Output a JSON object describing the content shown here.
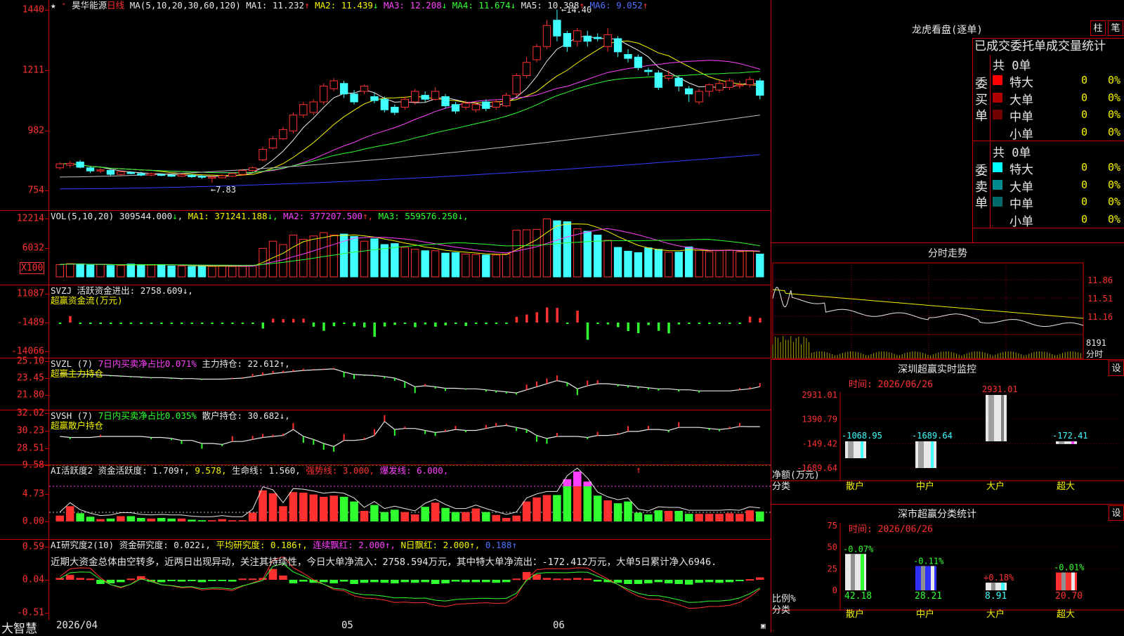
{
  "header": {
    "stock_name": "昊华能源",
    "period": "日线",
    "ma_params": "MA(5,10,20,30,60,120)",
    "ma_values": [
      {
        "label": "MA1:",
        "value": "11.232",
        "arrow": "↑",
        "color": "#e8e8e8"
      },
      {
        "label": "MA2:",
        "value": "11.439",
        "arrow": "↓",
        "color": "#f5f500"
      },
      {
        "label": "MA3:",
        "value": "12.208",
        "arrow": "↓",
        "color": "#ff40ff"
      },
      {
        "label": "MA4:",
        "value": "11.674",
        "arrow": "↓",
        "color": "#30ff30"
      },
      {
        "label": "MA5:",
        "value": "10.398",
        "arrow": "↑",
        "color": "#e8e8e8"
      },
      {
        "label": "MA6:",
        "value": "9.052",
        "arrow": "↑",
        "color": "#5070ff"
      }
    ],
    "high_mark": "14.40",
    "low_mark": "7.83"
  },
  "panels": {
    "price": {
      "ticks": [
        "1440",
        "1211",
        "982",
        "754"
      ]
    },
    "vol": {
      "ticks": [
        "12214",
        "6032"
      ],
      "unit_box": "X100",
      "label": "VOL(5,10,20)",
      "value": "309544.000",
      "value_arrow": "↓",
      "ma": [
        {
          "label": "MA1:",
          "value": "371241.188",
          "arrow": "↓",
          "color": "#f5f500"
        },
        {
          "label": "MA2:",
          "value": "377207.500",
          "arrow": "↑",
          "color": "#ff40ff"
        },
        {
          "label": "MA3:",
          "value": "559576.250",
          "arrow": "↓",
          "color": "#30ff30"
        }
      ]
    },
    "svzj": {
      "ticks": [
        "11087",
        "-1489",
        "-14066"
      ],
      "name": "SVZJ",
      "text": "活跃资金进出: 2758.609↓,",
      "subtitle": "超赢资金流(万元)"
    },
    "svzl": {
      "ticks": [
        "25.10",
        "23.45",
        "21.80"
      ],
      "name": "SVZL (7)",
      "ratio_text": "7日内买卖净占比0.071%",
      "text": "主力持仓: 22.612↑,",
      "subtitle": "超赢主力持仓"
    },
    "svsh": {
      "ticks": [
        "32.02",
        "30.23",
        "28.51"
      ],
      "name": "SVSH (7)",
      "ratio_text": "7日内买卖净占比0.035%",
      "text": "散户持仓: 30.682↓,",
      "subtitle": "超赢散户持仓"
    },
    "hyd": {
      "ticks": [
        "9.58",
        "4.73",
        "0.00"
      ],
      "name": "AI活跃度2",
      "text1": "资金活跃度: 1.709↑,",
      "text2": "9.578,",
      "text3": "生命线: 1.560,",
      "text4": "强势线: 3.000,",
      "text5": "爆发线: 6.000,",
      "arrow_mark": "↑"
    },
    "yjd": {
      "ticks": [
        "0.59",
        "0.04",
        "-0.51"
      ],
      "name": "AI研究度2(10)",
      "text1": "资金研究度: 0.022↓,",
      "text2": "平均研究度: 0.186↑,",
      "text3": "连续飘红: 2.000↑,",
      "text4": "N日飘红: 2.000↑,",
      "text5": "0.188↑",
      "commentary": "近期大资金总体由空转多，近两日出现异动，关注其持续性，今日大单净流入：2758.594万元，其中特大单净流出：-172.412万元，大单5日累计净入6946."
    }
  },
  "statusbar": {
    "brand": "大智慧",
    "date": "2026/04",
    "month1": "05",
    "month2": "06"
  },
  "right": {
    "lhkp": {
      "title": "龙虎看盘(逐单)",
      "btn1": "柱",
      "btn2": "笔",
      "tabs": "已成交委托单成交量统计",
      "buy": {
        "group_label": "委买单",
        "total": "共 0单",
        "rows": [
          {
            "label": "特大",
            "value": "0",
            "pct": "0%",
            "color": "#ff0000"
          },
          {
            "label": "大单",
            "value": "0",
            "pct": "0%",
            "color": "#b00000"
          },
          {
            "label": "中单",
            "value": "0",
            "pct": "0%",
            "color": "#700000"
          },
          {
            "label": "小单",
            "value": "0",
            "pct": "0%",
            "color": "#000000"
          }
        ]
      },
      "sell": {
        "group_label": "委卖单",
        "total": "共 0单",
        "rows": [
          {
            "label": "特大",
            "value": "0",
            "pct": "0%",
            "color": "#00ffff"
          },
          {
            "label": "大单",
            "value": "0",
            "pct": "0%",
            "color": "#008c8c"
          },
          {
            "label": "中单",
            "value": "0",
            "pct": "0%",
            "color": "#006a6a"
          },
          {
            "label": "小单",
            "value": "0",
            "pct": "0%",
            "color": "#000000"
          }
        ]
      }
    },
    "fszs": {
      "title": "分时走势",
      "ticks": [
        "11.86",
        "11.51",
        "11.16"
      ],
      "vol_tick": "8191",
      "vol_label": "分时"
    },
    "szjk": {
      "title": "深圳超赢实时监控",
      "settings": "设",
      "date_label": "时间: 2026/06/26",
      "ticks": [
        "2931.01",
        "1390.79",
        "-149.42",
        "-1689.64"
      ],
      "ylabel": "净额(万元)",
      "xlabel": "分类"
    },
    "fltj": {
      "title": "深市超赢分类统计",
      "settings": "设",
      "date_label": "时间: 2026/06/26",
      "ticks": [
        "75",
        "50",
        "25",
        "0"
      ],
      "ylabel": "比例%",
      "xlabel": "分类"
    }
  },
  "chart_data": [
    {
      "type": "candlestick",
      "title": "昊华能源 日线",
      "ylim": [
        7.3,
        14.5
      ],
      "ohlc": [
        [
          8.4,
          8.55,
          8.6,
          8.33
        ],
        [
          8.5,
          8.57,
          8.65,
          8.4
        ],
        [
          8.62,
          8.42,
          8.7,
          8.38
        ],
        [
          8.4,
          8.28,
          8.45,
          8.2
        ],
        [
          8.3,
          8.32,
          8.38,
          8.2
        ],
        [
          8.3,
          8.15,
          8.35,
          8.1
        ],
        [
          8.15,
          8.25,
          8.3,
          8.1
        ],
        [
          8.22,
          8.2,
          8.26,
          8.15
        ],
        [
          8.18,
          8.12,
          8.25,
          8.08
        ],
        [
          8.12,
          8.18,
          8.22,
          8.08
        ],
        [
          8.15,
          8.12,
          8.18,
          8.08
        ],
        [
          8.12,
          8.08,
          8.16,
          8.05
        ],
        [
          8.08,
          8.14,
          8.18,
          8.05
        ],
        [
          8.12,
          8.06,
          8.16,
          8.02
        ],
        [
          8.08,
          8.05,
          8.12,
          7.98
        ],
        [
          8.05,
          8.05,
          8.1,
          7.83
        ],
        [
          8.02,
          8.1,
          8.15,
          8.0
        ],
        [
          8.08,
          8.18,
          8.22,
          8.05
        ],
        [
          8.15,
          8.3,
          8.35,
          8.1
        ],
        [
          8.3,
          8.4,
          8.45,
          8.25
        ],
        [
          8.7,
          9.1,
          9.2,
          8.65
        ],
        [
          9.15,
          9.5,
          9.6,
          9.1
        ],
        [
          9.5,
          9.85,
          9.95,
          9.45
        ],
        [
          9.8,
          10.4,
          10.5,
          9.7
        ],
        [
          10.4,
          10.8,
          10.9,
          10.3
        ],
        [
          10.5,
          10.9,
          11.0,
          10.4
        ],
        [
          10.9,
          11.5,
          11.6,
          10.8
        ],
        [
          11.4,
          11.7,
          11.8,
          11.3
        ],
        [
          11.6,
          11.2,
          11.7,
          11.05
        ],
        [
          11.2,
          10.9,
          11.35,
          10.8
        ],
        [
          11.3,
          11.5,
          11.55,
          11.2
        ],
        [
          11.1,
          10.95,
          11.25,
          10.85
        ],
        [
          11.0,
          10.6,
          11.1,
          10.5
        ],
        [
          10.7,
          10.5,
          10.8,
          10.4
        ],
        [
          10.7,
          11.0,
          11.1,
          10.6
        ],
        [
          10.9,
          11.3,
          11.4,
          10.8
        ],
        [
          11.15,
          11.0,
          11.3,
          10.9
        ],
        [
          11.0,
          11.3,
          11.45,
          10.95
        ],
        [
          11.1,
          10.75,
          11.2,
          10.65
        ],
        [
          10.8,
          10.55,
          10.9,
          10.45
        ],
        [
          10.7,
          10.85,
          10.95,
          10.6
        ],
        [
          10.6,
          10.8,
          10.9,
          10.5
        ],
        [
          10.9,
          10.65,
          11.0,
          10.55
        ],
        [
          10.7,
          10.9,
          11.0,
          10.6
        ],
        [
          10.75,
          11.15,
          11.25,
          10.7
        ],
        [
          11.2,
          11.9,
          12.0,
          11.1
        ],
        [
          11.9,
          12.4,
          12.6,
          11.8
        ],
        [
          12.5,
          13.0,
          13.1,
          12.4
        ],
        [
          13.0,
          13.8,
          14.0,
          12.9
        ],
        [
          14.0,
          13.4,
          14.4,
          13.2
        ],
        [
          13.5,
          13.0,
          13.6,
          12.8
        ],
        [
          13.2,
          13.6,
          13.7,
          13.0
        ],
        [
          13.4,
          13.2,
          13.6,
          13.0
        ],
        [
          13.35,
          13.3,
          13.5,
          13.2
        ],
        [
          13.0,
          13.45,
          13.7,
          12.8
        ],
        [
          13.3,
          12.8,
          13.4,
          12.6
        ],
        [
          12.7,
          12.55,
          12.9,
          12.4
        ],
        [
          12.6,
          12.2,
          12.7,
          12.1
        ],
        [
          12.1,
          12.05,
          12.2,
          11.9
        ],
        [
          12.0,
          11.45,
          12.1,
          11.35
        ],
        [
          11.8,
          11.9,
          12.1,
          11.7
        ],
        [
          11.8,
          11.5,
          11.9,
          11.3
        ],
        [
          11.4,
          11.2,
          11.5,
          10.9
        ],
        [
          10.9,
          11.3,
          11.4,
          10.8
        ],
        [
          11.3,
          11.55,
          11.6,
          11.1
        ],
        [
          11.35,
          11.6,
          11.7,
          11.25
        ],
        [
          11.45,
          11.7,
          11.8,
          11.35
        ],
        [
          11.55,
          11.55,
          11.7,
          11.4
        ],
        [
          11.55,
          11.75,
          11.85,
          11.45
        ],
        [
          11.7,
          11.15,
          11.8,
          11.0
        ]
      ]
    },
    {
      "type": "bar",
      "name": "VOL",
      "ylim": [
        0,
        13000
      ],
      "values": [
        2600,
        2800,
        2700,
        2500,
        2600,
        2400,
        2400,
        2700,
        2600,
        2500,
        2600,
        2300,
        2300,
        2200,
        2300,
        2200,
        2300,
        2200,
        2200,
        2300,
        6000,
        7500,
        6800,
        8800,
        7900,
        8600,
        9300,
        8800,
        9000,
        8500,
        7500,
        8000,
        6800,
        7000,
        6200,
        5800,
        5500,
        5500,
        5000,
        5100,
        4800,
        4700,
        4600,
        4600,
        4800,
        9800,
        9900,
        10000,
        12200,
        11800,
        11600,
        10100,
        9600,
        8800,
        7700,
        6200,
        5400,
        5100,
        6100,
        5800,
        5200,
        5200,
        6300,
        5600,
        5300,
        5500,
        5600,
        5300,
        5500,
        4800
      ]
    },
    {
      "type": "bar",
      "name": "SVZJ",
      "ylim": [
        -14066,
        11087
      ],
      "values": [
        -300,
        2800,
        -200,
        -100,
        -100,
        -200,
        -200,
        -300,
        -300,
        -200,
        -200,
        -100,
        -300,
        -300,
        -100,
        -200,
        -200,
        -200,
        -500,
        -600,
        -2600,
        1700,
        1500,
        1600,
        1700,
        -1800,
        -3600,
        -1600,
        -300,
        -1600,
        -2100,
        -6200,
        -1700,
        -1000,
        -300,
        -2000,
        -800,
        -1800,
        -1200,
        -600,
        -1500,
        -400,
        -700,
        -300,
        -300,
        2500,
        3500,
        4500,
        6600,
        6400,
        -200,
        5200,
        -7500,
        -300,
        -800,
        -2000,
        -3700,
        -4600,
        -1100,
        -3600,
        -4700,
        -800,
        -400,
        -300,
        -200,
        -600,
        -200,
        -100,
        2600,
        2000
      ]
    },
    {
      "type": "line",
      "name": "SVZL",
      "ylim": [
        21.8,
        25.1
      ],
      "values": [
        23.9,
        23.85,
        23.85,
        23.8,
        23.75,
        23.7,
        23.65,
        23.6,
        23.55,
        23.5,
        23.5,
        23.45,
        23.4,
        23.4,
        23.35,
        23.35,
        23.35,
        23.4,
        23.45,
        23.6,
        23.75,
        23.9,
        24.0,
        24.1,
        24.2,
        24.25,
        24.3,
        24.35,
        24.05,
        23.8,
        23.75,
        23.7,
        23.6,
        23.45,
        23.1,
        22.6,
        22.7,
        22.6,
        22.45,
        22.45,
        22.4,
        22.4,
        22.3,
        22.2,
        22.1,
        22.0,
        22.3,
        22.6,
        22.9,
        23.2,
        23.0,
        22.4,
        22.7,
        22.9,
        22.9,
        22.8,
        22.7,
        22.6,
        22.5,
        22.4,
        22.4,
        22.3,
        22.3,
        22.2,
        22.2,
        22.2,
        22.2,
        22.3,
        22.4,
        22.61
      ]
    },
    {
      "type": "line",
      "name": "SVSH",
      "ylim": [
        28.51,
        32.02
      ],
      "values": [
        29.7,
        29.6,
        29.6,
        29.6,
        29.7,
        29.7,
        29.7,
        29.7,
        29.7,
        29.6,
        29.6,
        29.5,
        29.3,
        29.3,
        29.0,
        29.0,
        28.9,
        29.2,
        29.2,
        29.4,
        29.6,
        29.7,
        29.8,
        30.4,
        29.7,
        29.4,
        29.0,
        28.7,
        29.3,
        29.3,
        29.4,
        29.8,
        31.2,
        30.4,
        30.5,
        30.5,
        30.3,
        30.1,
        30.2,
        30.4,
        30.3,
        30.3,
        30.5,
        30.7,
        30.8,
        30.6,
        30.4,
        29.8,
        29.5,
        29.7,
        29.7,
        29.7,
        29.6,
        29.8,
        29.8,
        29.9,
        30.2,
        30.2,
        30.4,
        30.4,
        30.3,
        30.6,
        30.6,
        30.6,
        30.5,
        30.4,
        30.5,
        30.7,
        30.68,
        30.68
      ]
    },
    {
      "type": "bar",
      "name": "AI活跃度2",
      "ylim": [
        0,
        9.58
      ],
      "values": [
        1.0,
        2.6,
        1.4,
        0.8,
        0.4,
        0.5,
        0.9,
        0.9,
        0.6,
        0.5,
        0.6,
        0.5,
        0.5,
        0.3,
        0.2,
        0.2,
        0.4,
        0.2,
        0.2,
        1.5,
        5.3,
        4.8,
        2.6,
        5.0,
        4.9,
        4.6,
        4.2,
        4.4,
        4.2,
        3.4,
        1.8,
        2.8,
        1.6,
        2.0,
        1.6,
        1.2,
        2.5,
        3.2,
        2.3,
        1.6,
        1.6,
        2.2,
        1.6,
        1.1,
        0.6,
        1.0,
        3.4,
        4.1,
        4.5,
        4.5,
        7.2,
        8.5,
        6.8,
        4.4,
        3.6,
        3.1,
        3.4,
        1.5,
        1.2,
        1.9,
        1.8,
        1.8,
        1.3,
        1.3,
        1.3,
        1.3,
        1.4,
        1.3,
        1.9,
        1.7
      ]
    },
    {
      "type": "bar",
      "name": "AI研究度2(10)",
      "ylim": [
        -0.51,
        0.59
      ],
      "values": [
        0.03,
        0.08,
        0.03,
        0.02,
        -0.07,
        -0.06,
        -0.04,
        0.02,
        0.06,
        -0.03,
        -0.04,
        -0.02,
        -0.03,
        -0.01,
        -0.04,
        -0.01,
        -0.02,
        -0.03,
        0.02,
        0.02,
        0.03,
        0.18,
        0.07,
        -0.06,
        -0.03,
        -0.05,
        -0.04,
        -0.06,
        -0.03,
        -0.07,
        -0.05,
        -0.04,
        -0.05,
        -0.06,
        -0.04,
        -0.05,
        -0.04,
        -0.07,
        -0.06,
        -0.03,
        -0.04,
        -0.04,
        -0.04,
        -0.05,
        -0.04,
        0.02,
        0.13,
        0.09,
        0.03,
        0.02,
        0.02,
        0.03,
        0.02,
        -0.03,
        -0.04,
        -0.05,
        -0.07,
        -0.07,
        -0.06,
        -0.04,
        -0.06,
        -0.07,
        -0.08,
        -0.05,
        -0.04,
        -0.05,
        -0.04,
        -0.02,
        0.01,
        0.04
      ]
    },
    {
      "type": "bar",
      "name": "深圳超赢实时监控",
      "ylim": [
        -1689.64,
        2931.01
      ],
      "categories": [
        "散户",
        "中户",
        "大户",
        "超大"
      ],
      "values": [
        -1068.95,
        -1689.64,
        2931.01,
        -172.41
      ],
      "labels": [
        "-1068.95",
        "-1689.64",
        "2931.01",
        "-172.41"
      ]
    },
    {
      "type": "bar",
      "name": "深市超赢分类统计",
      "ylim": [
        0,
        75
      ],
      "categories": [
        "散户",
        "中户",
        "大户",
        "超大"
      ],
      "values": [
        42.18,
        28.21,
        8.91,
        20.7
      ],
      "top_labels": [
        "-0.07%",
        "-0.11%",
        "+0.18%",
        "-0.01%"
      ]
    }
  ],
  "colors": {
    "up": "#ff3030",
    "down": "#40ffff",
    "axis": "#cc0000",
    "bg": "#000000"
  }
}
